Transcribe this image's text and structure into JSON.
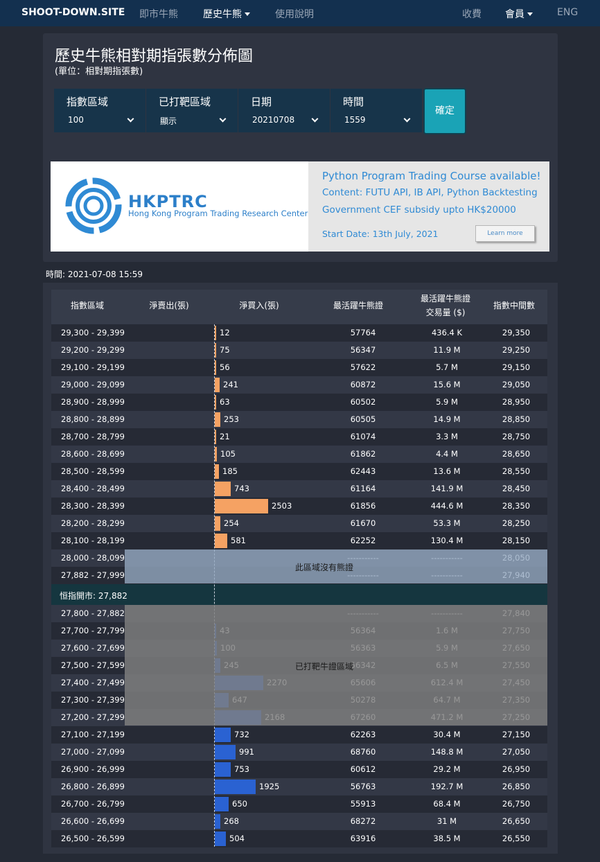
{
  "nav": {
    "brand": "SHOOT-DOWN.SITE",
    "link1": "即市牛熊",
    "link2": "歷史牛熊",
    "link3": "使用說明",
    "link4": "收費",
    "link5": "會員",
    "link6": "ENG"
  },
  "page": {
    "title": "歷史牛熊相對期指張數分佈圖",
    "subtitle": "(單位：相對期指張數)"
  },
  "filters": {
    "index_zone_label": "指數區域",
    "index_zone_value": "100",
    "shot_zone_label": "已打靶區域",
    "shot_zone_value": "顯示",
    "date_label": "日期",
    "date_value": "20210708",
    "time_label": "時間",
    "time_value": "1559",
    "confirm": "確定"
  },
  "banner": {
    "brand": "HKPTRC",
    "brand_sub": "Hong Kong Program Trading Research Center",
    "line1": "Python Program Trading Course available!",
    "line2": "Content: FUTU API, IB API, Python Backtesting",
    "line3": "Government CEF subsidy upto HK$20000",
    "line4": "Start Date: 13th July, 2021",
    "button": "Learn more"
  },
  "time_line": "時間: 2021-07-08 15:59",
  "table": {
    "headers": {
      "range": "指數區域",
      "sell": "淨賣出(張)",
      "buy": "淨買入(張)",
      "name": "最活躍牛熊證",
      "vol1": "最活躍牛熊證",
      "vol2": "交易量 ($)",
      "mid": "指數中間數"
    },
    "market_row": "恒指開市: 27,882",
    "overlay_no_bear": "此區域沒有熊證",
    "overlay_hit": "已打靶牛證區域",
    "max_value": 2503,
    "rows": [
      {
        "range": "29,300 - 29,399",
        "buy": "12",
        "name": "57764",
        "vol": "436.4 K",
        "mid": "29,350",
        "v": 12,
        "color": "orange"
      },
      {
        "range": "29,200 - 29,299",
        "buy": "75",
        "name": "56347",
        "vol": "11.9 M",
        "mid": "29,250",
        "v": 75,
        "color": "orange"
      },
      {
        "range": "29,100 - 29,199",
        "buy": "56",
        "name": "57622",
        "vol": "5.7 M",
        "mid": "29,150",
        "v": 56,
        "color": "orange"
      },
      {
        "range": "29,000 - 29,099",
        "buy": "241",
        "name": "60872",
        "vol": "15.6 M",
        "mid": "29,050",
        "v": 241,
        "color": "orange"
      },
      {
        "range": "28,900 - 28,999",
        "buy": "63",
        "name": "60502",
        "vol": "5.9 M",
        "mid": "28,950",
        "v": 63,
        "color": "orange"
      },
      {
        "range": "28,800 - 28,899",
        "buy": "253",
        "name": "60505",
        "vol": "14.9 M",
        "mid": "28,850",
        "v": 253,
        "color": "orange"
      },
      {
        "range": "28,700 - 28,799",
        "buy": "21",
        "name": "61074",
        "vol": "3.3 M",
        "mid": "28,750",
        "v": 21,
        "color": "orange"
      },
      {
        "range": "28,600 - 28,699",
        "buy": "105",
        "name": "61862",
        "vol": "4.4 M",
        "mid": "28,650",
        "v": 105,
        "color": "orange"
      },
      {
        "range": "28,500 - 28,599",
        "buy": "185",
        "name": "62443",
        "vol": "13.6 M",
        "mid": "28,550",
        "v": 185,
        "color": "orange"
      },
      {
        "range": "28,400 - 28,499",
        "buy": "743",
        "name": "61164",
        "vol": "141.9 M",
        "mid": "28,450",
        "v": 743,
        "color": "orange"
      },
      {
        "range": "28,300 - 28,399",
        "buy": "2503",
        "name": "61856",
        "vol": "444.6 M",
        "mid": "28,350",
        "v": 2503,
        "color": "orange"
      },
      {
        "range": "28,200 - 28,299",
        "buy": "254",
        "name": "61670",
        "vol": "53.3 M",
        "mid": "28,250",
        "v": 254,
        "color": "orange"
      },
      {
        "range": "28,100 - 28,199",
        "buy": "581",
        "name": "62252",
        "vol": "130.4 M",
        "mid": "28,150",
        "v": 581,
        "color": "orange"
      },
      {
        "range": "28,000 - 28,099",
        "buy": "",
        "name": "-----------",
        "vol": "-----------",
        "mid": "28,050",
        "v": 0,
        "color": "orange"
      },
      {
        "range": "27,882 - 27,999",
        "buy": "",
        "name": "-----------",
        "vol": "-----------",
        "mid": "27,940",
        "v": 0,
        "color": "orange"
      },
      {
        "range": "27,800 - 27,882",
        "buy": "",
        "name": "-----------",
        "vol": "-----------",
        "mid": "27,840",
        "v": 0,
        "color": "blue"
      },
      {
        "range": "27,700 - 27,799",
        "buy": "43",
        "name": "56364",
        "vol": "1.6 M",
        "mid": "27,750",
        "v": 43,
        "color": "blue"
      },
      {
        "range": "27,600 - 27,699",
        "buy": "100",
        "name": "56363",
        "vol": "5.9 M",
        "mid": "27,650",
        "v": 100,
        "color": "blue"
      },
      {
        "range": "27,500 - 27,599",
        "buy": "245",
        "name": "56342",
        "vol": "6.5 M",
        "mid": "27,550",
        "v": 245,
        "color": "blue"
      },
      {
        "range": "27,400 - 27,499",
        "buy": "2270",
        "name": "65606",
        "vol": "612.4 M",
        "mid": "27,450",
        "v": 2270,
        "color": "blue"
      },
      {
        "range": "27,300 - 27,399",
        "buy": "647",
        "name": "50278",
        "vol": "64.7 M",
        "mid": "27,350",
        "v": 647,
        "color": "blue"
      },
      {
        "range": "27,200 - 27,299",
        "buy": "2168",
        "name": "67260",
        "vol": "471.2 M",
        "mid": "27,250",
        "v": 2168,
        "color": "blue"
      },
      {
        "range": "27,100 - 27,199",
        "buy": "732",
        "name": "62263",
        "vol": "30.4 M",
        "mid": "27,150",
        "v": 732,
        "color": "blue"
      },
      {
        "range": "27,000 - 27,099",
        "buy": "991",
        "name": "68760",
        "vol": "148.8 M",
        "mid": "27,050",
        "v": 991,
        "color": "blue"
      },
      {
        "range": "26,900 - 26,999",
        "buy": "753",
        "name": "60612",
        "vol": "29.2 M",
        "mid": "26,950",
        "v": 753,
        "color": "blue"
      },
      {
        "range": "26,800 - 26,899",
        "buy": "1925",
        "name": "56763",
        "vol": "192.7 M",
        "mid": "26,850",
        "v": 1925,
        "color": "blue"
      },
      {
        "range": "26,700 - 26,799",
        "buy": "650",
        "name": "55913",
        "vol": "68.4 M",
        "mid": "26,750",
        "v": 650,
        "color": "blue"
      },
      {
        "range": "26,600 - 26,699",
        "buy": "268",
        "name": "68272",
        "vol": "31 M",
        "mid": "26,650",
        "v": 268,
        "color": "blue"
      },
      {
        "range": "26,500 - 26,599",
        "buy": "504",
        "name": "63916",
        "vol": "38.5 M",
        "mid": "26,550",
        "v": 504,
        "color": "blue"
      }
    ]
  },
  "colors": {
    "bull_bar": "#2a62d2",
    "bear_bar": "#f5a263",
    "nav_bg": "#13304f",
    "confirm_bg": "#1aa3b6"
  }
}
